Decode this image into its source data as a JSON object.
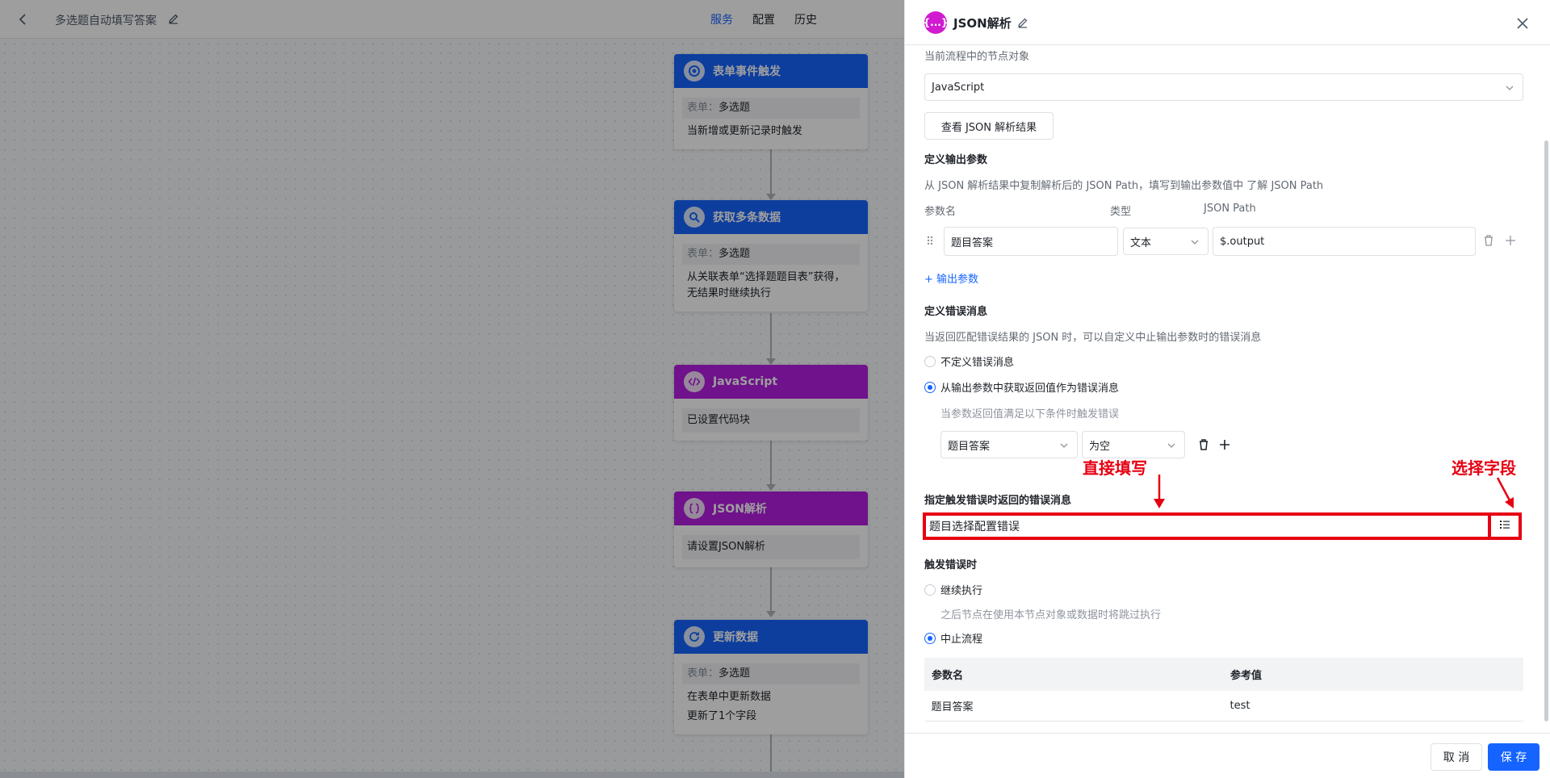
{
  "topbar": {
    "title": "多选题自动填写答案",
    "tabs": [
      {
        "label": "服务",
        "active": true
      },
      {
        "label": "配置",
        "active": false
      },
      {
        "label": "历史",
        "active": false
      }
    ]
  },
  "nodes": [
    {
      "title": "表单事件触发",
      "color": "#1664ff",
      "icon": "target-icon",
      "form_label": "表单：",
      "form_value": "多选题",
      "desc": "当新增或更新记录时触发"
    },
    {
      "title": "获取多条数据",
      "color": "#1664ff",
      "icon": "search-data-icon",
      "form_label": "表单：",
      "form_value": "多选题",
      "desc": "从关联表单“选择题题目表”获得，无结果时继续执行"
    },
    {
      "title": "JavaScript",
      "color": "#b41ee0",
      "icon": "code-icon",
      "desc": "已设置代码块"
    },
    {
      "title": "JSON解析",
      "color": "#b41ee0",
      "icon": "json-icon",
      "desc": "请设置JSON解析"
    },
    {
      "title": "更新数据",
      "color": "#1664ff",
      "icon": "refresh-icon",
      "form_label": "表单：",
      "form_value": "多选题",
      "desc": "在表单中更新数据",
      "desc2": "更新了1个字段"
    }
  ],
  "panel": {
    "logo": "{...}",
    "title": "JSON解析",
    "source_label": "当前流程中的节点对象",
    "source_value": "JavaScript",
    "view_result_button": "查看 JSON 解析结果",
    "output_section_title": "定义输出参数",
    "output_hint": "从 JSON 解析结果中复制解析后的 JSON Path，填写到输出参数值中 了解 JSON Path",
    "output_columns": [
      "参数名",
      "类型",
      "JSON Path"
    ],
    "output_param": {
      "name": "题目答案",
      "type": "文本",
      "path": "$.output"
    },
    "add_output_link": "+ 输出参数",
    "error_section_title": "定义错误消息",
    "error_hint": "当返回匹配错误结果的 JSON 时，可以自定义中止输出参数时的错误消息",
    "error_options": [
      {
        "label": "不定义错误消息",
        "checked": false
      },
      {
        "label": "从输出参数中获取返回值作为错误消息",
        "checked": true
      }
    ],
    "condition_hint": "当参数返回值满足以下条件时触发错误",
    "condition": {
      "field": "题目答案",
      "operator": "为空"
    },
    "error_message_label": "指定触发错误时返回的错误消息",
    "error_message_value": "题目选择配置错误",
    "on_error_title": "触发错误时",
    "on_error_options": [
      {
        "label": "继续执行",
        "checked": false,
        "hint": "之后节点在使用本节点对象或数据时将跳过执行"
      },
      {
        "label": "中止流程",
        "checked": true
      }
    ],
    "ref_table": {
      "headers": [
        "参数名",
        "参考值"
      ],
      "rows": [
        [
          "题目答案",
          "test"
        ]
      ]
    },
    "cancel_button": "取 消",
    "save_button": "保 存"
  },
  "annotations": {
    "direct_fill": "直接填写",
    "select_field": "选择字段",
    "color": "#e60012"
  }
}
